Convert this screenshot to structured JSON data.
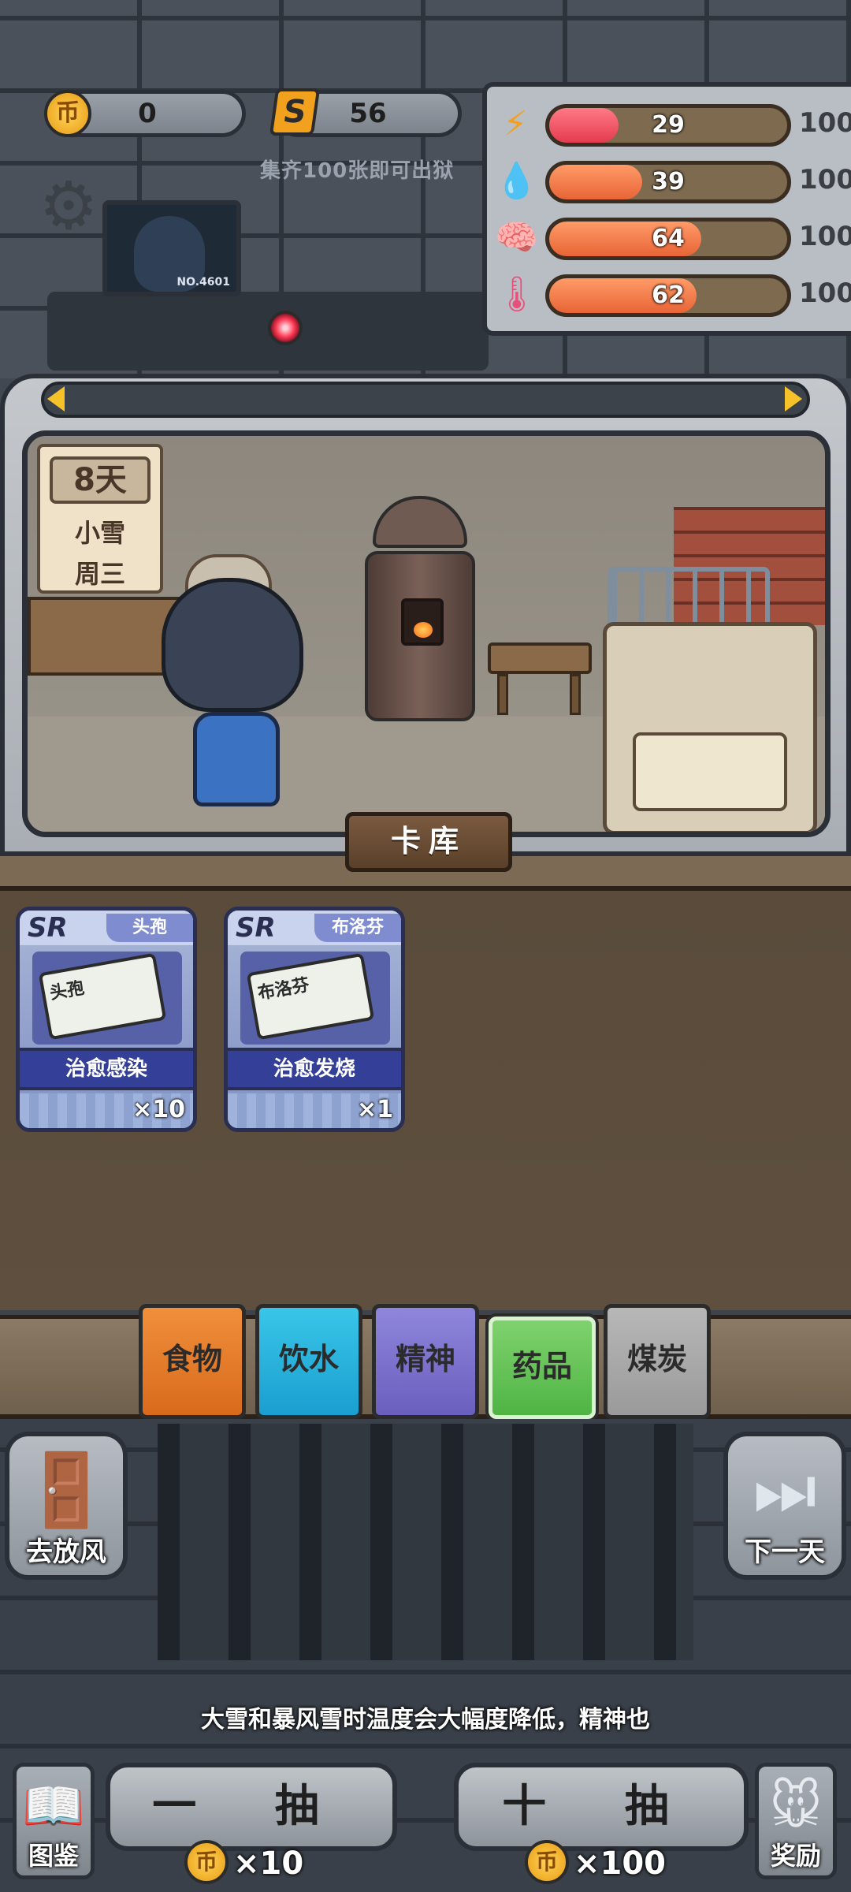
{
  "currency": {
    "coins": "0",
    "coin_symbol": "币",
    "tickets": "56",
    "ticket_symbol": "S"
  },
  "hint": "集齐100张即可出狱",
  "stats": [
    {
      "icon": "lightning-icon",
      "value": "29",
      "max": "100",
      "fraction": 0.29
    },
    {
      "icon": "water-drop-icon",
      "value": "39",
      "max": "100",
      "fraction": 0.39
    },
    {
      "icon": "brain-icon",
      "value": "64",
      "max": "100",
      "fraction": 0.64
    },
    {
      "icon": "thermometer-icon",
      "value": "62",
      "max": "100",
      "fraction": 0.62
    }
  ],
  "monitor_no": "NO.4601",
  "calendar": {
    "day": "8天",
    "weather": "小雪",
    "weekday": "周三"
  },
  "inventory_tab": "卡库",
  "cards": [
    {
      "rarity": "SR",
      "name": "头孢",
      "pack_text": "头孢",
      "effect": "治愈感染",
      "count": "×10"
    },
    {
      "rarity": "SR",
      "name": "布洛芬",
      "pack_text": "布洛芬",
      "effect": "治愈发烧",
      "count": "×1"
    }
  ],
  "categories": {
    "food": "食物",
    "water": "饮水",
    "mind": "精神",
    "medicine": "药品",
    "coal": "煤炭"
  },
  "buttons": {
    "go_out": "去放风",
    "next_day": "下一天",
    "draw_one": "一 抽",
    "draw_ten": "十 抽",
    "gallery": "图鉴",
    "reward": "奖励"
  },
  "costs": {
    "coin_symbol": "币",
    "one": "×10",
    "ten": "×100"
  },
  "tip": "大雪和暴风雪时温度会大幅度降低，精神也",
  "colors": {
    "bar_fill": "#e86436",
    "bar_fill_low": "#e43b4f",
    "selected_category": "#4fb444"
  }
}
